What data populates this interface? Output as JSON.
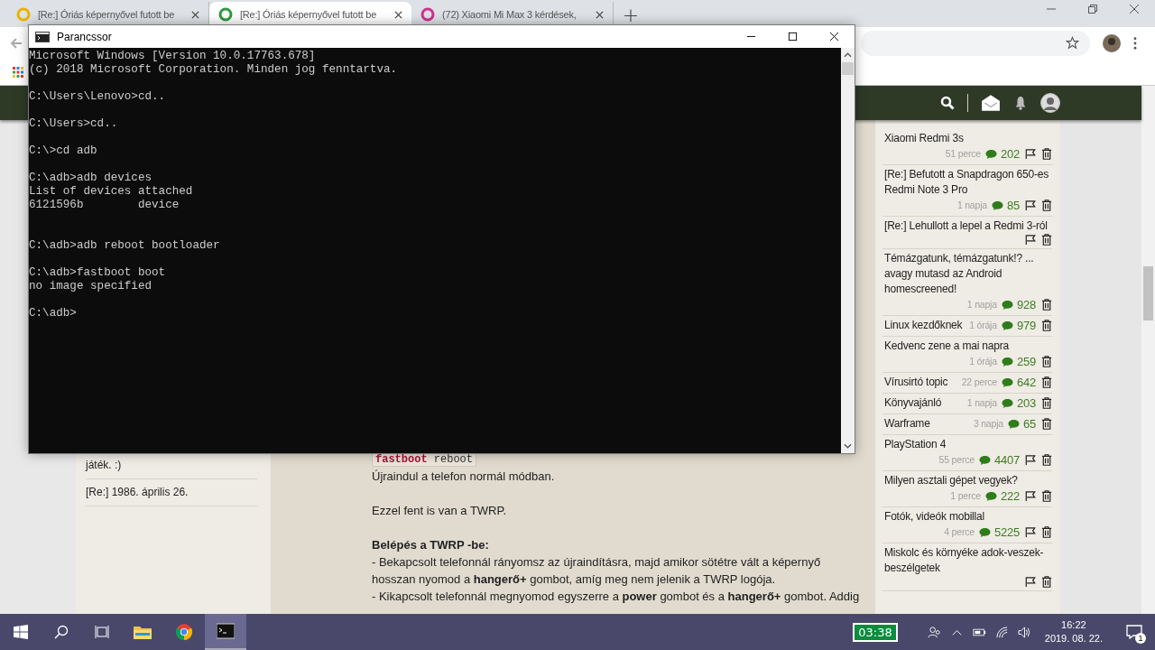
{
  "browser": {
    "tabs": [
      {
        "title": "[Re:] Óriás képernyővel futott be",
        "color": "#e8b400",
        "selected": false
      },
      {
        "title": "[Re:] Óriás képernyővel futott be",
        "color": "#2e9a3e",
        "selected": true
      },
      {
        "title": "(72) Xiaomi Mi Max 3 kérdések,",
        "color": "#d0308c",
        "selected": false
      }
    ],
    "new_tab": "+"
  },
  "page": {
    "left_sidebar": [
      {
        "title": "játék. :)"
      },
      {
        "title": "[Re:] 1986. április 26."
      }
    ],
    "article": {
      "code_keyword": "fastboot",
      "code_rest": "reboot",
      "paragraphs": [
        [
          "Újraindul a telefon normál módban."
        ],
        [
          "Ezzel fent is van a TWRP."
        ],
        [
          "**Belépés a TWRP -be:**",
          "- Bekapcsolt telefonnál rányomsz az újraindításra, majd amikor sötétre vált a képernyő hosszan nyomod a **hangerő+** gombot, amíg meg nem jelenik a TWRP logója.",
          "- Kikapcsolt telefonnál megnyomod egyszerre a **power** gombot és a **hangerő+** gombot. Addig"
        ]
      ]
    },
    "right_sidebar": [
      {
        "title": "Xiaomi Redmi 3s",
        "time": "51 perce",
        "count": "202",
        "flag": true
      },
      {
        "title": "[Re:] Befutott a Snapdragon 650-es Redmi Note 3 Pro",
        "time": "1 napja",
        "count": "85",
        "flag": true
      },
      {
        "title": "[Re:] Lehullott a lepel a Redmi 3-ról",
        "flag": true
      },
      {
        "title": "Témázgatunk, témázgatunk!? ... avagy mutasd az Android homescreened!",
        "time": "1 napja",
        "count": "928",
        "flag": false
      },
      {
        "title": "Linux kezdőknek",
        "time": "1 órája",
        "count": "979",
        "flag": false
      },
      {
        "title": "Kedvenc zene a mai napra",
        "time": "1 órája",
        "count": "259",
        "flag": false
      },
      {
        "title": "Vírusirtó topic",
        "time": "22 perce",
        "count": "642",
        "flag": false
      },
      {
        "title": "Könyvajánló",
        "time": "1 napja",
        "count": "203",
        "flag": false
      },
      {
        "title": "Warframe",
        "time": "3 napja",
        "count": "65",
        "flag": false
      },
      {
        "title": "PlayStation 4",
        "time": "55 perce",
        "count": "4407",
        "flag": true
      },
      {
        "title": "Milyen asztali gépet vegyek?",
        "time": "1 perce",
        "count": "222",
        "flag": true
      },
      {
        "title": "Fotók, videók mobillal",
        "time": "4 perce",
        "count": "5225",
        "flag": true
      },
      {
        "title": "Miskolc és környéke adok-veszek-beszélgetek",
        "flag": true
      }
    ]
  },
  "console": {
    "title": "Parancssor",
    "blocks": [
      {
        "lines": [
          "Microsoft Windows [Version 10.0.17763.678]",
          "(c) 2018 Microsoft Corporation. Minden jog fenntartva."
        ],
        "extra_gap": false
      },
      {
        "lines": [
          "C:\\Users\\Lenovo>cd.."
        ],
        "extra_gap": false
      },
      {
        "lines": [
          "C:\\Users>cd.."
        ],
        "extra_gap": false
      },
      {
        "lines": [
          "C:\\>cd adb"
        ],
        "extra_gap": false
      },
      {
        "lines": [
          "C:\\adb>adb devices",
          "List of devices attached",
          "6121596b        device"
        ],
        "extra_gap": false
      },
      {
        "lines": [
          "C:\\adb>adb reboot bootloader"
        ],
        "extra_gap": true
      },
      {
        "lines": [
          "C:\\adb>fastboot boot",
          "no image specified"
        ],
        "extra_gap": false
      },
      {
        "lines": [
          "C:\\adb>"
        ],
        "extra_gap": false
      }
    ]
  },
  "taskbar": {
    "apps": [
      {
        "kind": "folder",
        "selected": false
      },
      {
        "kind": "chrome",
        "selected": false
      },
      {
        "kind": "terminal",
        "selected": true
      }
    ],
    "widget": "03:38",
    "time": "16:22",
    "date": "2019. 08. 22.",
    "notifications": "1"
  }
}
